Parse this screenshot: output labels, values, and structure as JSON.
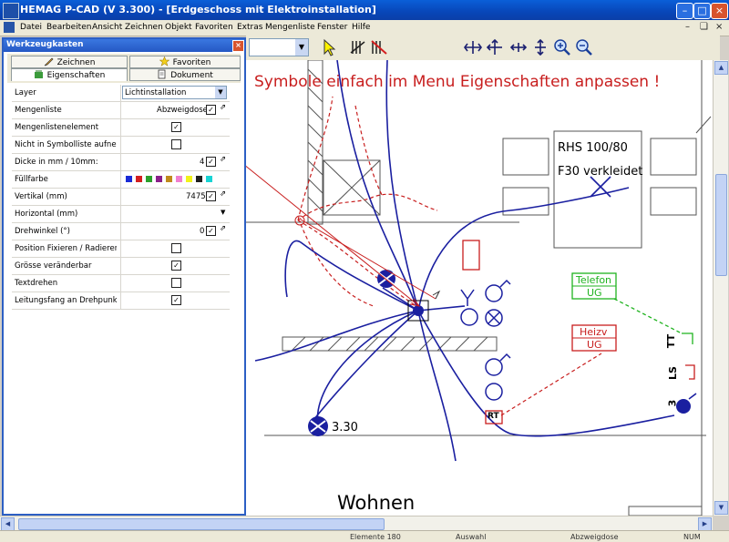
{
  "window": {
    "title": "HEMAG P-CAD (V 3.300) - [Erdgeschoss mit Elektroinstallation]"
  },
  "menu": {
    "items": [
      "Datei",
      "Bearbeiten",
      "Ansicht",
      "Zeichnen",
      "Objekt",
      "Favoriten",
      "Extras",
      "Mengenliste",
      "Fenster",
      "Hilfe"
    ]
  },
  "palette": {
    "title": "Werkzeugkasten",
    "tabs": [
      {
        "label": "Zeichnen",
        "icon": "pencil-icon"
      },
      {
        "label": "Favoriten",
        "icon": "star-icon"
      },
      {
        "label": "Eigenschaften",
        "icon": "properties-icon",
        "active": true
      },
      {
        "label": "Dokument",
        "icon": "document-icon"
      }
    ],
    "properties": [
      {
        "label": "Layer",
        "value": "Lichtinstallation",
        "kind": "select"
      },
      {
        "label": "Mengenliste",
        "value": "Abzweigdose",
        "kind": "text-check"
      },
      {
        "label": "Mengenlistenelement",
        "checked": true,
        "kind": "check"
      },
      {
        "label": "Nicht in Symbolliste aufnehmen",
        "checked": false,
        "kind": "check"
      },
      {
        "label": "Dicke in mm / 10mm:",
        "value": "4",
        "kind": "text-check"
      },
      {
        "label": "Füllfarbe",
        "kind": "colors"
      },
      {
        "label": "Vertikal (mm)",
        "value": "7475",
        "kind": "text-check"
      },
      {
        "label": "Horizontal (mm)",
        "kind": "dropdown-empty"
      },
      {
        "label": "Drehwinkel (°)",
        "value": "0",
        "kind": "text-check"
      },
      {
        "label": "Position Fixieren / Radieren",
        "checked": false,
        "kind": "check"
      },
      {
        "label": "Grösse veränderbar",
        "checked": true,
        "kind": "check"
      },
      {
        "label": "Textdrehen",
        "checked": false,
        "kind": "check"
      },
      {
        "label": "Leitungsfang an Drehpunkt",
        "checked": true,
        "kind": "check"
      }
    ],
    "colors": [
      "#1a2bd6",
      "#d41f1f",
      "#2ba02b",
      "#8a1f8a",
      "#c08a1a",
      "#f07fd0",
      "#f2f21a",
      "#1f1f1f",
      "#18d4d4"
    ]
  },
  "canvas": {
    "annotation": "Symbole einfach im Menu Eigenschaften anpassen !",
    "labels": {
      "rhs": "RHS 100/80",
      "f30": "F30 verkleidet",
      "telefon": "Telefon",
      "telefon_ug": "UG",
      "heizv": "Heizv",
      "heizv_ug": "UG",
      "rt": "RT",
      "height": "3.30",
      "room": "Wohnen",
      "tt": "TT",
      "ls": "LS",
      "three": "3"
    },
    "colors": {
      "blue": "#1a1fa0",
      "red": "#c81e1e",
      "green": "#1fb31f"
    }
  },
  "status": {
    "cells": [
      "Elemente 180",
      "Auswahl",
      "Abzweigdose",
      "NUM"
    ]
  }
}
